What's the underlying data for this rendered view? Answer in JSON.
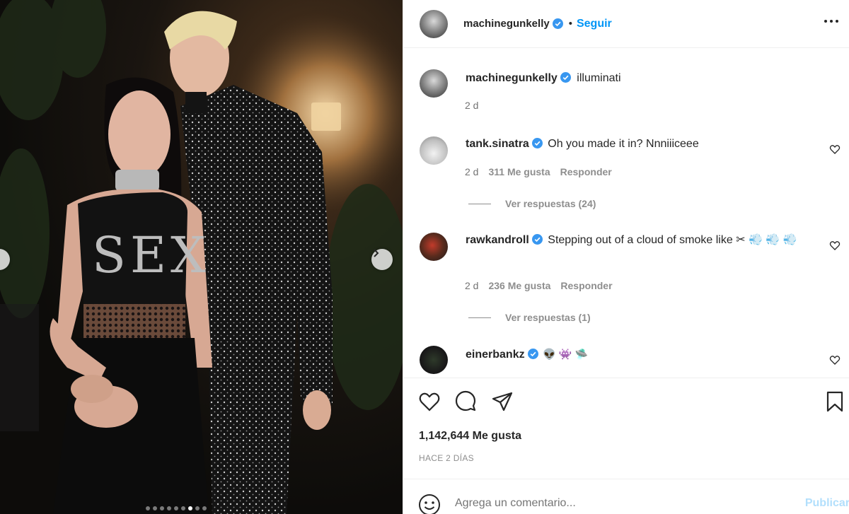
{
  "post": {
    "author": "machinegunkelly",
    "follow_label": "Seguir",
    "separator": "•",
    "more_icon": "ellipsis-icon",
    "verified_icon": "verified-badge-icon",
    "accent_color": "#0095f6"
  },
  "caption": {
    "username": "machinegunkelly",
    "text": "illuminati",
    "age": "2 d"
  },
  "comments": [
    {
      "username": "tank.sinatra",
      "text": "Oh you made it in? Nnniiiceee",
      "age": "2 d",
      "likes": "311 Me gusta",
      "reply_label": "Responder",
      "view_replies": "Ver respuestas (24)"
    },
    {
      "username": "rawkandroll",
      "text": "Stepping out of a cloud of smoke like ✂ 💨 💨 💨",
      "age": "2 d",
      "likes": "236 Me gusta",
      "reply_label": "Responder",
      "view_replies": "Ver respuestas (1)"
    },
    {
      "username": "einerbankz",
      "text": "👽 👾 🛸"
    }
  ],
  "actions": {
    "like_icon": "heart-icon",
    "comment_icon": "comment-bubble-icon",
    "share_icon": "paper-plane-icon",
    "save_icon": "bookmark-icon"
  },
  "likes_count": "1,142,644 Me gusta",
  "timestamp": "HACE 2 DÍAS",
  "composer": {
    "placeholder": "Agrega un comentario...",
    "post_label": "Publicar",
    "emoji_icon": "smiley-icon"
  },
  "carousel": {
    "total": 9,
    "active_index": 6
  }
}
